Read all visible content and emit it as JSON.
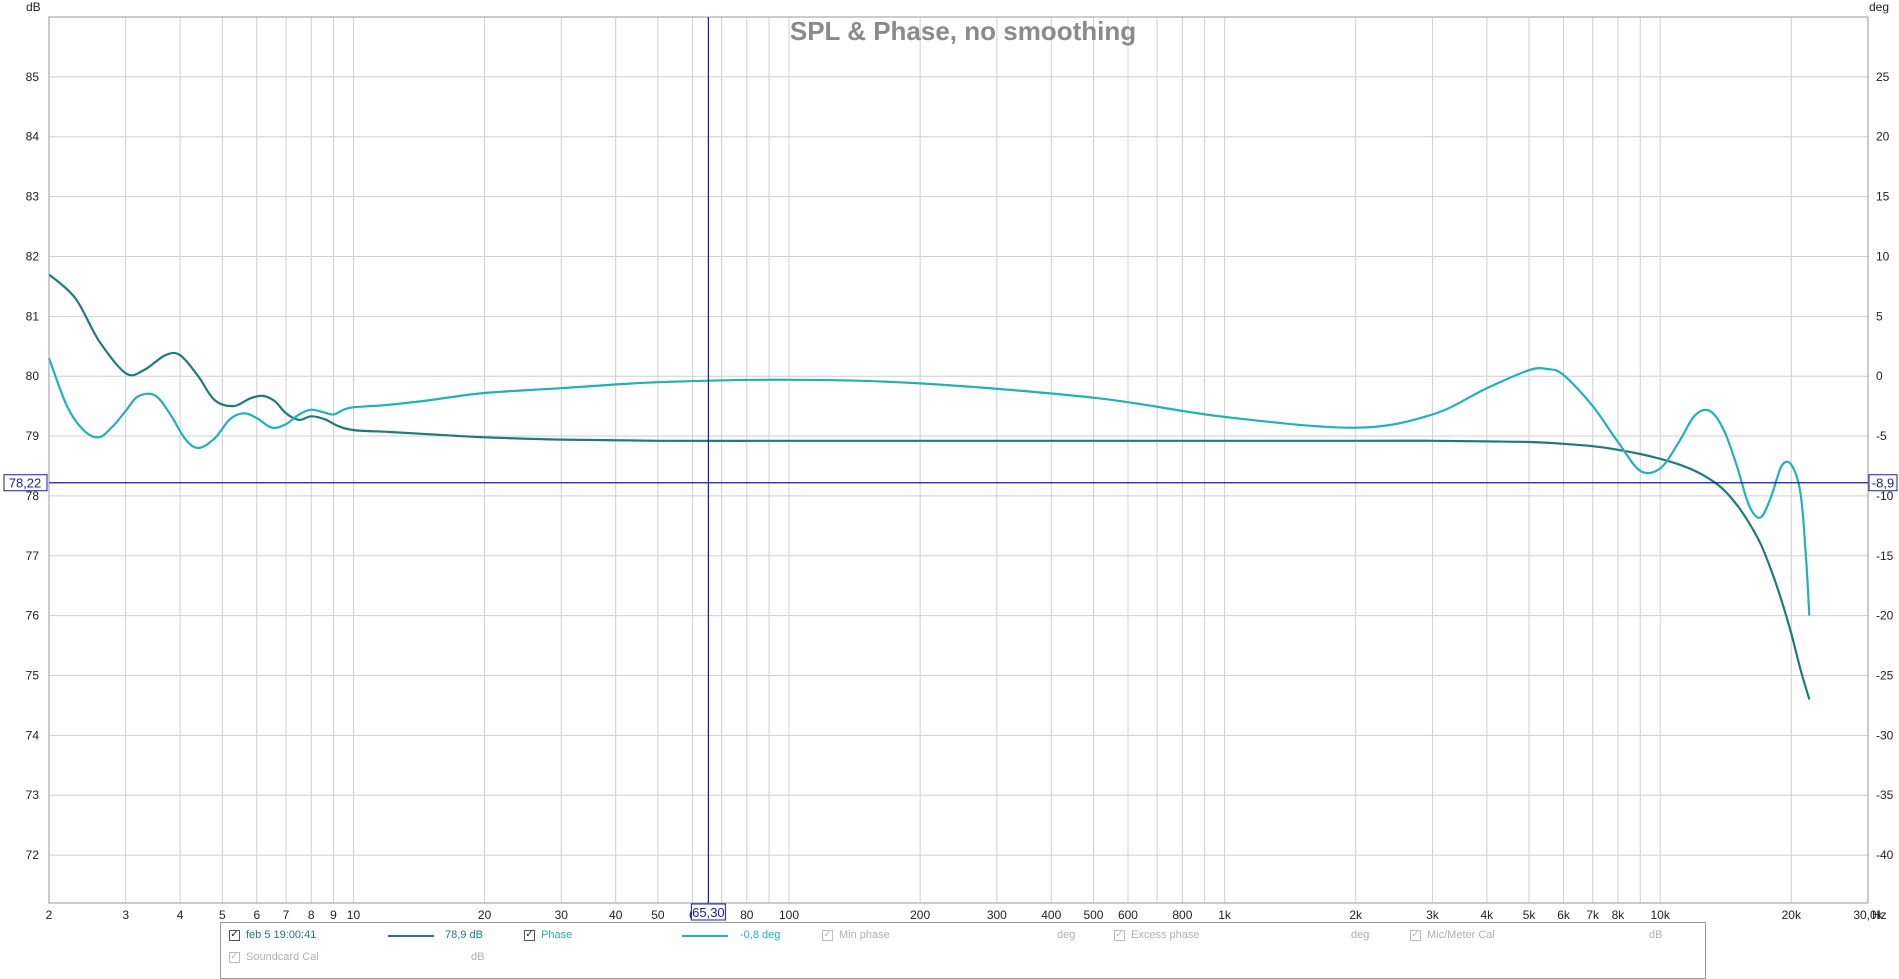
{
  "chart_data": {
    "type": "line",
    "title": "SPL & Phase, no smoothing",
    "xscale": "log",
    "xlim": [
      2,
      30000
    ],
    "x_unit": "Hz",
    "x_ticks": [
      {
        "v": 2,
        "label": "2"
      },
      {
        "v": 3,
        "label": "3"
      },
      {
        "v": 4,
        "label": "4"
      },
      {
        "v": 5,
        "label": "5"
      },
      {
        "v": 6,
        "label": "6"
      },
      {
        "v": 7,
        "label": "7"
      },
      {
        "v": 8,
        "label": "8"
      },
      {
        "v": 9,
        "label": "9"
      },
      {
        "v": 10,
        "label": "10"
      },
      {
        "v": 20,
        "label": "20"
      },
      {
        "v": 30,
        "label": "30"
      },
      {
        "v": 40,
        "label": "40"
      },
      {
        "v": 50,
        "label": "50"
      },
      {
        "v": 60,
        "label": "6"
      },
      {
        "v": 80,
        "label": "80"
      },
      {
        "v": 100,
        "label": "100"
      },
      {
        "v": 200,
        "label": "200"
      },
      {
        "v": 300,
        "label": "300"
      },
      {
        "v": 400,
        "label": "400"
      },
      {
        "v": 500,
        "label": "500"
      },
      {
        "v": 600,
        "label": "600"
      },
      {
        "v": 800,
        "label": "800"
      },
      {
        "v": 1000,
        "label": "1k"
      },
      {
        "v": 2000,
        "label": "2k"
      },
      {
        "v": 3000,
        "label": "3k"
      },
      {
        "v": 4000,
        "label": "4k"
      },
      {
        "v": 5000,
        "label": "5k"
      },
      {
        "v": 6000,
        "label": "6k"
      },
      {
        "v": 7000,
        "label": "7k"
      },
      {
        "v": 8000,
        "label": "8k"
      },
      {
        "v": 10000,
        "label": "10k"
      },
      {
        "v": 20000,
        "label": "20k"
      },
      {
        "v": 30000,
        "label": "30,0k"
      }
    ],
    "y_left": {
      "unit": "dB",
      "ylim": [
        71.2,
        86.0
      ],
      "ticks": [
        72,
        73,
        74,
        75,
        76,
        77,
        78,
        79,
        80,
        81,
        82,
        83,
        84,
        85
      ]
    },
    "y_right": {
      "unit": "deg",
      "ylim": [
        -44,
        30
      ],
      "ticks": [
        -40,
        -35,
        -30,
        -25,
        -20,
        -15,
        -10,
        -5,
        0,
        5,
        10,
        15,
        20,
        25
      ]
    },
    "grid": true,
    "cursor": {
      "x": 65.3,
      "x_label": "65,30",
      "y_left": 78.22,
      "left_label": "78,22",
      "right_label": "-8,9"
    },
    "series": [
      {
        "name": "feb 5 19:00:41",
        "axis": "left",
        "color": "#1f7a7a",
        "x": [
          2,
          2.3,
          2.6,
          3,
          3.3,
          3.7,
          4,
          4.4,
          4.8,
          5.3,
          5.8,
          6.2,
          6.6,
          7,
          7.5,
          8,
          8.6,
          9.2,
          10,
          12,
          15,
          20,
          30,
          50,
          100,
          200,
          500,
          1000,
          2000,
          3000,
          4000,
          5000,
          6000,
          7000,
          8000,
          9000,
          10000,
          11000,
          12000,
          13000,
          14000,
          15000,
          16000,
          17000,
          18000,
          19000,
          20000,
          21000,
          22000
        ],
        "y": [
          81.7,
          81.3,
          80.6,
          80.05,
          80.1,
          80.35,
          80.35,
          80.0,
          79.6,
          79.5,
          79.63,
          79.67,
          79.58,
          79.38,
          79.27,
          79.33,
          79.28,
          79.17,
          79.1,
          79.07,
          79.03,
          78.98,
          78.94,
          78.92,
          78.92,
          78.92,
          78.92,
          78.92,
          78.92,
          78.92,
          78.91,
          78.9,
          78.87,
          78.83,
          78.77,
          78.7,
          78.62,
          78.53,
          78.42,
          78.28,
          78.1,
          77.85,
          77.55,
          77.2,
          76.75,
          76.25,
          75.7,
          75.1,
          74.6
        ]
      },
      {
        "name": "Phase",
        "axis": "right",
        "color": "#22b2b2",
        "x": [
          2,
          2.2,
          2.4,
          2.6,
          2.8,
          3,
          3.2,
          3.5,
          3.8,
          4.1,
          4.4,
          4.8,
          5.2,
          5.6,
          6,
          6.5,
          7,
          7.5,
          8,
          8.5,
          9,
          9.5,
          10,
          12,
          15,
          20,
          30,
          50,
          100,
          200,
          500,
          1000,
          2000,
          3000,
          4000,
          5000,
          5500,
          6000,
          7000,
          8000,
          9000,
          10000,
          11000,
          12000,
          13000,
          14000,
          15000,
          16000,
          17000,
          18000,
          19000,
          20000,
          21000,
          21600,
          22000
        ],
        "y": [
          1.5,
          -2.5,
          -4.5,
          -5.1,
          -4.2,
          -2.9,
          -1.7,
          -1.6,
          -3.2,
          -5.2,
          -6.0,
          -5.2,
          -3.6,
          -3.1,
          -3.5,
          -4.3,
          -4.0,
          -3.2,
          -2.8,
          -3.0,
          -3.2,
          -2.8,
          -2.6,
          -2.4,
          -2.0,
          -1.4,
          -1.0,
          -0.5,
          -0.3,
          -0.6,
          -1.8,
          -3.4,
          -4.3,
          -3.2,
          -1.0,
          0.5,
          0.6,
          0.1,
          -2.5,
          -5.5,
          -7.9,
          -7.7,
          -5.6,
          -3.3,
          -2.9,
          -4.5,
          -7.5,
          -10.8,
          -11.8,
          -10.0,
          -7.5,
          -7.4,
          -9.8,
          -15.0,
          -20.0
        ]
      }
    ]
  },
  "legend": {
    "row1": [
      {
        "label": "feb 5 19:00:41",
        "checked": true,
        "enabled": true,
        "value": "78,9 dB",
        "color": "#1f7a7a"
      },
      {
        "label": "Phase",
        "checked": true,
        "enabled": true,
        "value": "-0,8 deg",
        "color": "#22b2b2"
      },
      {
        "label": "Min phase",
        "checked": true,
        "enabled": false,
        "value": "deg"
      },
      {
        "label": "Excess phase",
        "checked": true,
        "enabled": false,
        "value": "deg"
      },
      {
        "label": "Mic/Meter Cal",
        "checked": true,
        "enabled": false,
        "value": "dB"
      }
    ],
    "row2": [
      {
        "label": "Soundcard Cal",
        "checked": true,
        "enabled": false,
        "value": "dB"
      }
    ]
  },
  "colors": {
    "grid": "#cfcfcf",
    "frame": "#9a9a9a",
    "cursor": "#1a1aa8",
    "title": "#8a8a8a"
  }
}
